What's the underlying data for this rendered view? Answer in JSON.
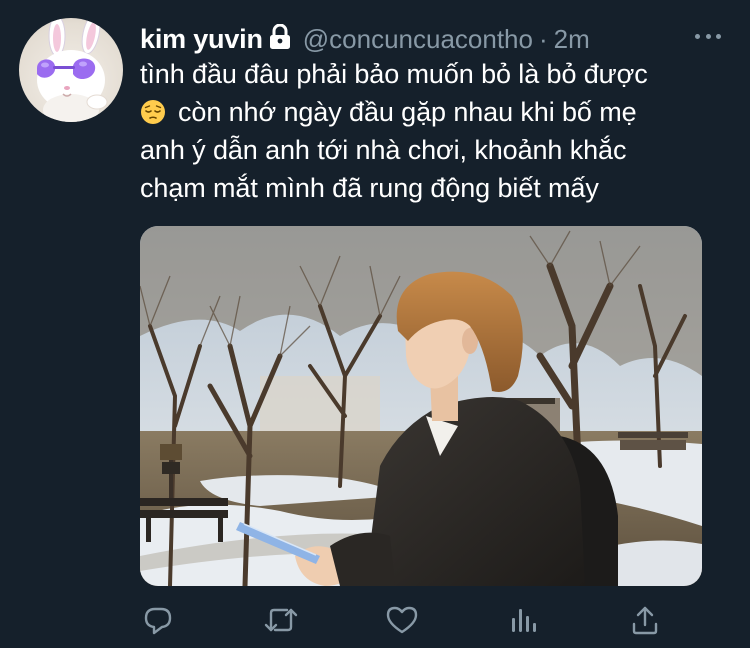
{
  "tweet": {
    "author": {
      "display_name": "kim yuvin",
      "handle": "@concuncuacontho",
      "protected_icon": "lock-icon",
      "avatar": "bunny-avatar-with-purple-heart-sunglasses"
    },
    "separator": "·",
    "timestamp": "2m",
    "text_lines": [
      "tình đầu đâu phải bảo muốn bỏ là bỏ được",
      "còn nhớ ngày đầu gặp nhau khi bố mẹ",
      "anh ý dẫn anh tới nhà chơi, khoảnh khắc",
      "chạm mắt mình đã rung động biết mấy"
    ],
    "emoji": "pensive-face",
    "media": {
      "type": "photo",
      "description_icon": "photo-outdoor-winter-park"
    },
    "actions": [
      {
        "name": "reply",
        "icon": "reply-icon"
      },
      {
        "name": "retweet",
        "icon": "retweet-icon"
      },
      {
        "name": "like",
        "icon": "heart-icon"
      },
      {
        "name": "analytics",
        "icon": "analytics-icon"
      },
      {
        "name": "share",
        "icon": "share-icon"
      }
    ],
    "more_icon": "more-options-icon"
  },
  "colors": {
    "background": "#15202b",
    "primary_text": "#ffffff",
    "secondary_text": "#8899a6",
    "accent_purple": "#9b6cf0"
  }
}
